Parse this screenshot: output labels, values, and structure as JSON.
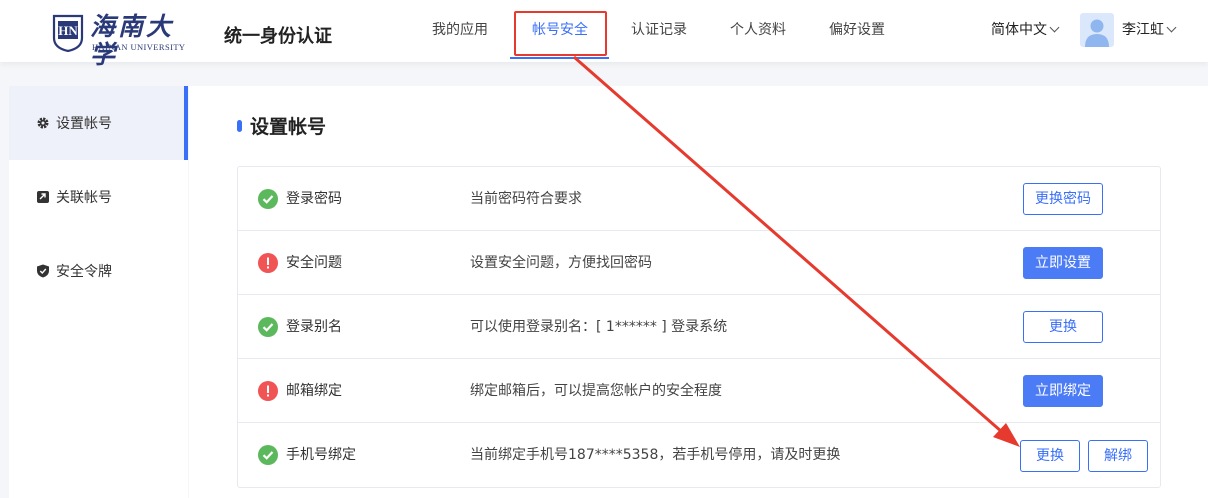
{
  "header": {
    "logo_cn": "海南大学",
    "logo_en": "HAINAN UNIVERSITY",
    "logo_seal": "HN",
    "app_title": "统一身份认证",
    "nav": [
      {
        "label": "我的应用",
        "active": false
      },
      {
        "label": "帐号安全",
        "active": true
      },
      {
        "label": "认证记录",
        "active": false
      },
      {
        "label": "个人资料",
        "active": false
      },
      {
        "label": "偏好设置",
        "active": false
      }
    ],
    "language": "简体中文",
    "username": "李江虹"
  },
  "sidebar": {
    "items": [
      {
        "label": "设置帐号",
        "icon": "gear-icon",
        "active": true
      },
      {
        "label": "关联帐号",
        "icon": "link-icon",
        "active": false
      },
      {
        "label": "安全令牌",
        "icon": "shield-icon",
        "active": false
      }
    ]
  },
  "main": {
    "section_title": "设置帐号",
    "rows": [
      {
        "status": "ok",
        "name": "登录密码",
        "desc": "当前密码符合要求",
        "buttons": [
          {
            "label": "更换密码",
            "style": "outline"
          }
        ]
      },
      {
        "status": "warn",
        "name": "安全问题",
        "desc": "设置安全问题，方便找回密码",
        "buttons": [
          {
            "label": "立即设置",
            "style": "solid"
          }
        ]
      },
      {
        "status": "ok",
        "name": "登录别名",
        "desc": "可以使用登录别名：[ 1****** ] 登录系统",
        "buttons": [
          {
            "label": "更换",
            "style": "outline"
          }
        ]
      },
      {
        "status": "warn",
        "name": "邮箱绑定",
        "desc": "绑定邮箱后，可以提高您帐户的安全程度",
        "buttons": [
          {
            "label": "立即绑定",
            "style": "solid"
          }
        ]
      },
      {
        "status": "ok",
        "name": "手机号绑定",
        "desc": "当前绑定手机号187****5358，若手机号停用，请及时更换",
        "buttons": [
          {
            "label": "更换",
            "style": "outline"
          },
          {
            "label": "解绑",
            "style": "outline"
          }
        ]
      }
    ]
  },
  "colors": {
    "accent": "#3a6ff7",
    "ok": "#5cb85c",
    "warn": "#f05454",
    "annotation": "#e63a2e"
  }
}
